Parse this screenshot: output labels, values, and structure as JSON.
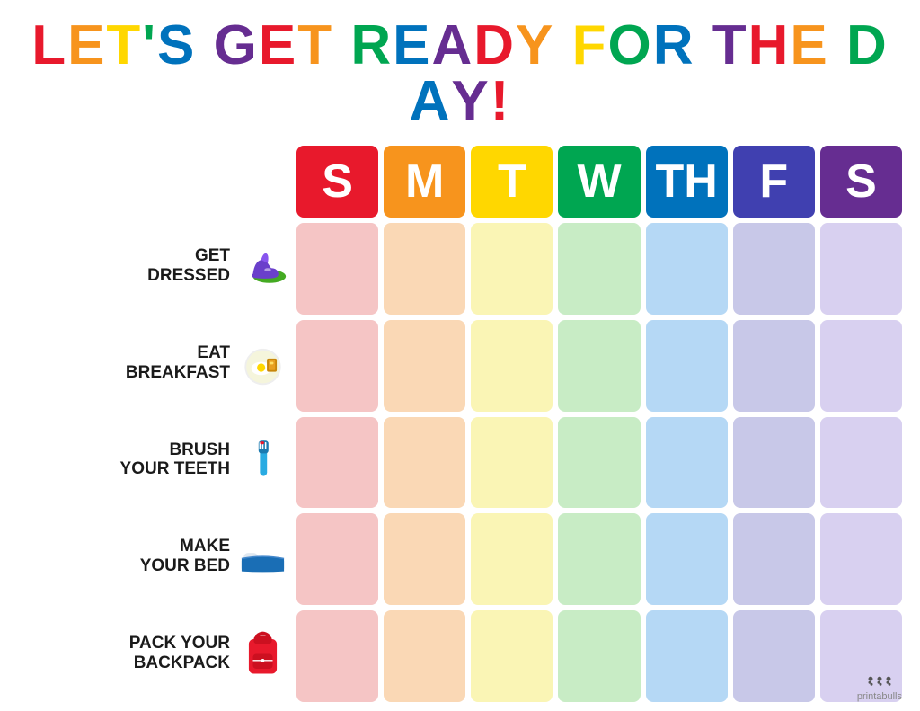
{
  "title": {
    "text": "LET'S GET READY FOR THE DAY!",
    "letters": [
      {
        "char": "L",
        "color": "#e8192c"
      },
      {
        "char": "E",
        "color": "#f7941d"
      },
      {
        "char": "T",
        "color": "#ffd700"
      },
      {
        "char": "'",
        "color": "#00a651"
      },
      {
        "char": "S",
        "color": "#0072bc"
      },
      {
        "char": " ",
        "color": "#000"
      },
      {
        "char": "G",
        "color": "#662d91"
      },
      {
        "char": "E",
        "color": "#e8192c"
      },
      {
        "char": "T",
        "color": "#f7941d"
      },
      {
        "char": " ",
        "color": "#000"
      },
      {
        "char": "R",
        "color": "#00a651"
      },
      {
        "char": "E",
        "color": "#0072bc"
      },
      {
        "char": "A",
        "color": "#662d91"
      },
      {
        "char": "D",
        "color": "#e8192c"
      },
      {
        "char": "Y",
        "color": "#f7941d"
      },
      {
        "char": " ",
        "color": "#000"
      },
      {
        "char": "F",
        "color": "#ffd700"
      },
      {
        "char": "O",
        "color": "#00a651"
      },
      {
        "char": "R",
        "color": "#0072bc"
      },
      {
        "char": " ",
        "color": "#000"
      },
      {
        "char": "T",
        "color": "#662d91"
      },
      {
        "char": "H",
        "color": "#e8192c"
      },
      {
        "char": "E",
        "color": "#f7941d"
      },
      {
        "char": " ",
        "color": "#000"
      },
      {
        "char": "D",
        "color": "#ffd700"
      },
      {
        "char": "A",
        "color": "#00a651"
      },
      {
        "char": "Y",
        "color": "#0072bc"
      },
      {
        "char": "!",
        "color": "#662d91"
      }
    ]
  },
  "days": [
    {
      "letter": "S",
      "color": "#e8192c"
    },
    {
      "letter": "M",
      "color": "#f7941d"
    },
    {
      "letter": "T",
      "color": "#ffd700"
    },
    {
      "letter": "W",
      "color": "#00a651"
    },
    {
      "letter": "TH",
      "color": "#0072bc"
    },
    {
      "letter": "F",
      "color": "#4040b0"
    },
    {
      "letter": "S",
      "color": "#662d91"
    }
  ],
  "tasks": [
    {
      "label": "GET\nDRESSED",
      "icon": "shoe"
    },
    {
      "label": "EAT\nBREAKFAST",
      "icon": "breakfast"
    },
    {
      "label": "BRUSH\nYOUR TEETH",
      "icon": "toothbrush"
    },
    {
      "label": "MAKE\nYOUR BED",
      "icon": "bed"
    },
    {
      "label": "PACK YOUR\nBACKPACK",
      "icon": "backpack"
    }
  ],
  "watermark": "printabulls"
}
